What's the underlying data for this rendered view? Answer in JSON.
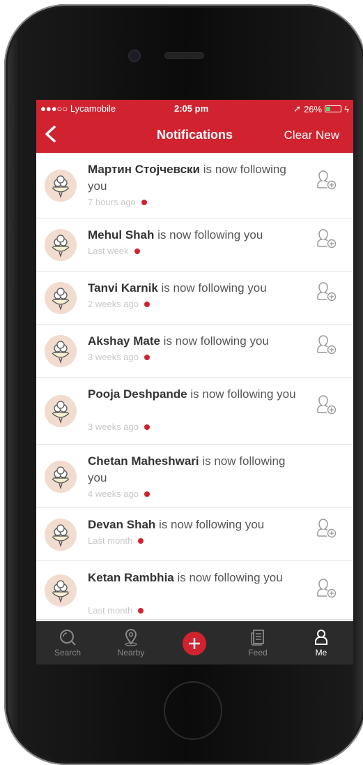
{
  "status_bar": {
    "carrier": "●●●○○ Lycamobile",
    "time": "2:05 pm",
    "battery": "26%"
  },
  "nav": {
    "title": "Notifications",
    "clear_new": "Clear New"
  },
  "notifications": [
    {
      "name": "Мартин Стојчевски",
      "text": " is now following you",
      "time": "7 hours ago",
      "followable": true
    },
    {
      "name": "Mehul Shah",
      "text": " is now following you",
      "time": "Last week",
      "followable": true
    },
    {
      "name": "Tanvi Karnik",
      "text": " is now following you",
      "time": "2 weeks ago",
      "followable": true
    },
    {
      "name": "Akshay Mate",
      "text": " is now following you",
      "time": "3 weeks ago",
      "followable": true
    },
    {
      "name": "Pooja Deshpande",
      "text": " is now following you",
      "time": "3 weeks ago",
      "followable": true
    },
    {
      "name": "Chetan Maheshwari",
      "text": " is now following you",
      "time": "4 weeks ago",
      "followable": false
    },
    {
      "name": "Devan Shah",
      "text": " is now following you",
      "time": "Last month",
      "followable": true
    },
    {
      "name": "Ketan Rambhia",
      "text": " is now following you",
      "time": "Last month",
      "followable": true
    }
  ],
  "tabs": [
    {
      "label": "Search",
      "icon": "search-icon"
    },
    {
      "label": "Nearby",
      "icon": "location-pin-icon"
    },
    {
      "label": "",
      "icon": "plus-icon"
    },
    {
      "label": "Feed",
      "icon": "feed-icon"
    },
    {
      "label": "Me",
      "icon": "person-icon"
    }
  ],
  "colors": {
    "accent": "#d0232f",
    "tabbar": "#2b2b2b",
    "unread_dot": "#d0232f"
  }
}
